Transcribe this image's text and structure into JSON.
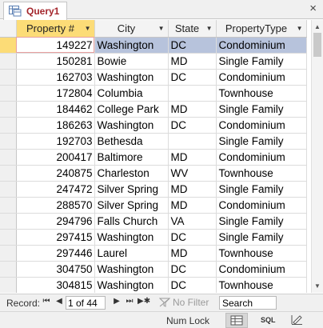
{
  "tab": {
    "title": "Query1",
    "close_glyph": "×"
  },
  "columns": [
    {
      "label": "Property #",
      "arrow": "▼"
    },
    {
      "label": "City",
      "arrow": "▼"
    },
    {
      "label": "State",
      "arrow": "▼"
    },
    {
      "label": "PropertyType",
      "arrow": "▼"
    }
  ],
  "rows": [
    {
      "id": "149227",
      "city": "Washington",
      "state": "DC",
      "type": "Condominium"
    },
    {
      "id": "150281",
      "city": "Bowie",
      "state": "MD",
      "type": "Single Family"
    },
    {
      "id": "162703",
      "city": "Washington",
      "state": "DC",
      "type": "Condominium"
    },
    {
      "id": "172804",
      "city": "Columbia",
      "state": "",
      "type": "Townhouse"
    },
    {
      "id": "184462",
      "city": "College Park",
      "state": "MD",
      "type": "Single Family"
    },
    {
      "id": "186263",
      "city": "Washington",
      "state": "DC",
      "type": "Condominium"
    },
    {
      "id": "192703",
      "city": "Bethesda",
      "state": "",
      "type": "Single Family"
    },
    {
      "id": "200417",
      "city": "Baltimore",
      "state": "MD",
      "type": "Condominium"
    },
    {
      "id": "240875",
      "city": "Charleston",
      "state": "WV",
      "type": "Townhouse"
    },
    {
      "id": "247472",
      "city": "Silver Spring",
      "state": "MD",
      "type": "Single Family"
    },
    {
      "id": "288570",
      "city": "Silver Spring",
      "state": "MD",
      "type": "Condominium"
    },
    {
      "id": "294796",
      "city": "Falls Church",
      "state": "VA",
      "type": "Single Family"
    },
    {
      "id": "297415",
      "city": "Washington",
      "state": "DC",
      "type": "Single Family"
    },
    {
      "id": "297446",
      "city": "Laurel",
      "state": "MD",
      "type": "Townhouse"
    },
    {
      "id": "304750",
      "city": "Washington",
      "state": "DC",
      "type": "Condominium"
    },
    {
      "id": "304815",
      "city": "Washington",
      "state": "DC",
      "type": "Townhouse"
    }
  ],
  "navigator": {
    "record_label": "Record:",
    "first": "⏮",
    "prev": "◀",
    "position": "1 of 44",
    "next": "▶",
    "last": "⏭",
    "new": "▶✱",
    "filter_label": "No Filter",
    "search_value": "Search"
  },
  "status": {
    "numlock": "Num Lock",
    "sql_label": "SQL"
  },
  "colors": {
    "accent": "#a4262c",
    "active_header": "#fcdc77",
    "selected_row": "#b7c3dc"
  }
}
